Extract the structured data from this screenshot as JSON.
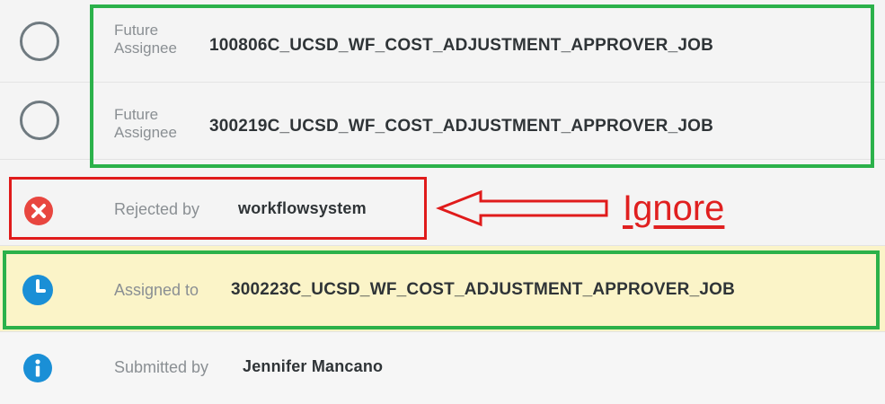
{
  "rows": [
    {
      "label": "Future\nAssignee",
      "value": "100806C_UCSD_WF_COST_ADJUSTMENT_APPROVER_JOB",
      "status": "pending",
      "icon": "empty-circle-icon"
    },
    {
      "label": "Future\nAssignee",
      "value": "300219C_UCSD_WF_COST_ADJUSTMENT_APPROVER_JOB",
      "status": "pending",
      "icon": "empty-circle-icon"
    },
    {
      "prefix": "Rejected by",
      "value": "workflowsystem",
      "status": "rejected",
      "icon": "rejected-x-icon",
      "color": "#e8463f"
    },
    {
      "prefix": "Assigned to",
      "value": "300223C_UCSD_WF_COST_ADJUSTMENT_APPROVER_JOB",
      "status": "assigned",
      "icon": "clock-icon",
      "color": "#1a8fd6"
    },
    {
      "prefix": "Submitted by",
      "value": "Jennifer Mancano",
      "status": "submitted",
      "icon": "info-icon",
      "color": "#1a8fd6"
    }
  ],
  "annotations": {
    "ignore_label": "Ignore",
    "highlight_color_keep": "#2bb14a",
    "highlight_color_ignore": "#e01b1b"
  }
}
